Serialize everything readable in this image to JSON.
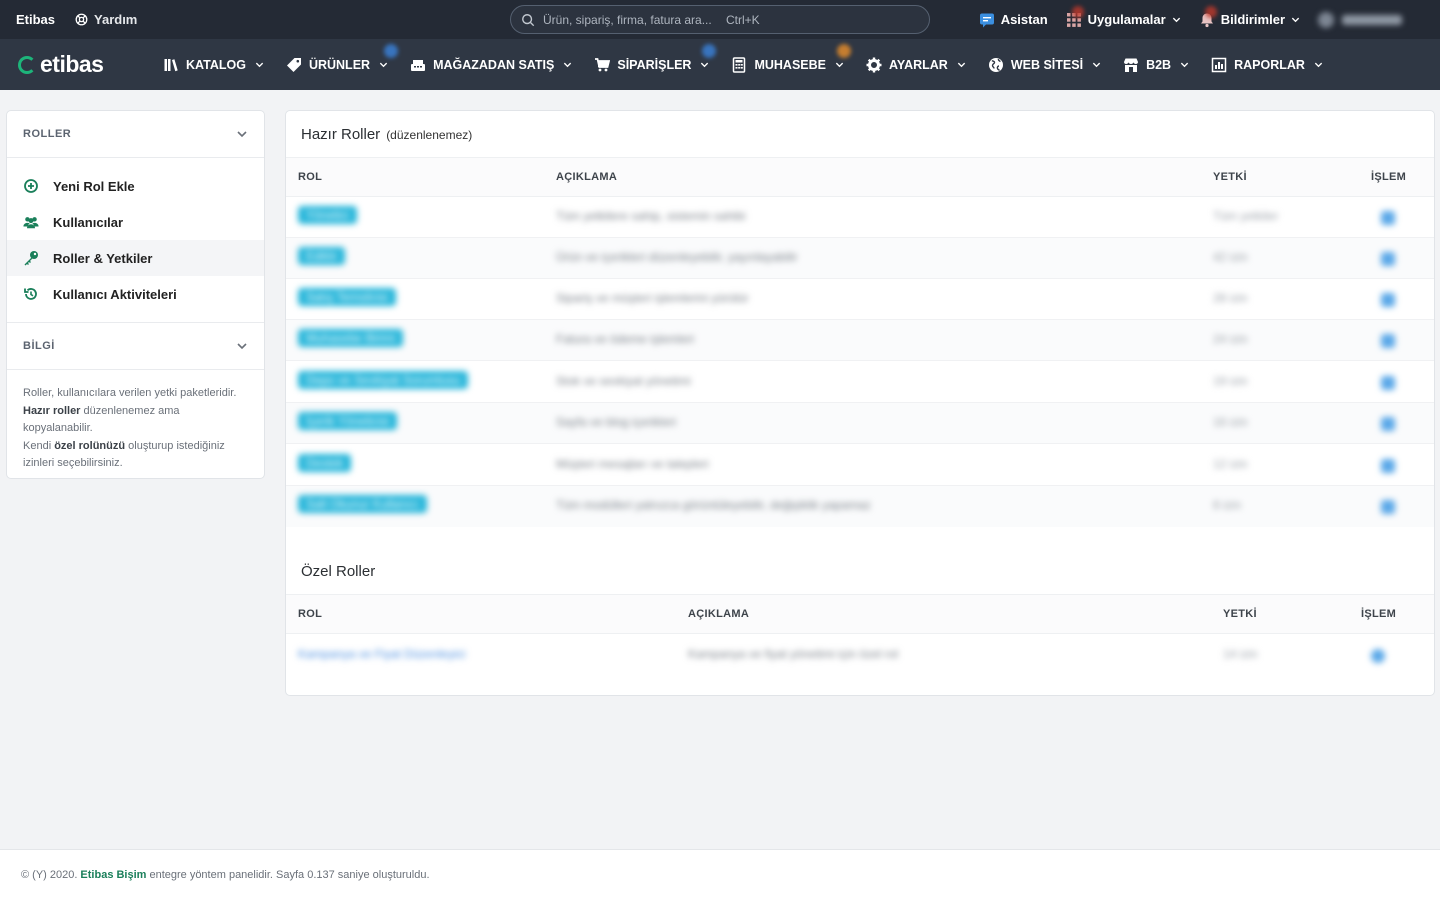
{
  "topbar": {
    "brand": "Etibas",
    "help": "Yardım",
    "search_placeholder": "Ürün, sipariş, firma, fatura ara...",
    "search_shortcut": "Ctrl+K",
    "assistant": "Asistan",
    "apps": "Uygulamalar",
    "notifications": "Bildirimler"
  },
  "navbar": {
    "logo": "etibas",
    "items": [
      {
        "label": "KATALOG",
        "icon": "books-icon"
      },
      {
        "label": "ÜRÜNLER",
        "icon": "tag-icon"
      },
      {
        "label": "MAĞAZADAN SATIŞ",
        "icon": "cash-register-icon"
      },
      {
        "label": "SİPARİŞLER",
        "icon": "cart-icon"
      },
      {
        "label": "MUHASEBE",
        "icon": "calculator-icon"
      },
      {
        "label": "AYARLAR",
        "icon": "gear-icon"
      },
      {
        "label": "WEB SİTESİ",
        "icon": "globe-icon"
      },
      {
        "label": "B2B",
        "icon": "store-icon"
      },
      {
        "label": "RAPORLAR",
        "icon": "report-icon"
      }
    ]
  },
  "sidebar": {
    "roles_header": "ROLLER",
    "items": [
      {
        "label": "Yeni Rol Ekle"
      },
      {
        "label": "Kullanıcılar"
      },
      {
        "label": "Roller & Yetkiler"
      },
      {
        "label": "Kullanıcı Aktiviteleri"
      }
    ],
    "info_header": "BİLGİ",
    "info": {
      "line1": "Roller, kullanıcılara verilen yetki paketleridir.",
      "b1": "Hazır roller",
      "t2": " düzenlenemez ama kopyalanabilir.",
      "t3": "Kendi ",
      "b2": "özel rolünüzü",
      "t4": " oluşturup istediğiniz izinleri seçebilirsiniz."
    }
  },
  "main": {
    "ready": {
      "title": "Hazır Roller",
      "subtitle": "(düzenlenemez)",
      "columns": {
        "role": "ROL",
        "desc": "AÇIKLAMA",
        "perm": "YETKİ",
        "action": "İŞLEM"
      },
      "rows": [
        {
          "role": "Yönetici",
          "desc": "Tüm yetkilere sahip, sistemin sahibi",
          "perm": "Tüm yetkiler"
        },
        {
          "role": "Editör",
          "desc": "Ürün ve içerikleri düzenleyebilir, yayınlayabilir",
          "perm": "42 izin"
        },
        {
          "role": "Satış Temsilcisi",
          "desc": "Sipariş ve müşteri işlemlerini yürütür",
          "perm": "28 izin"
        },
        {
          "role": "Muhasebe Birimi",
          "desc": "Fatura ve ödeme işlemleri",
          "perm": "24 izin"
        },
        {
          "role": "Depo ve Sevkiyat Sorumlusu",
          "desc": "Stok ve sevkiyat yönetimi",
          "perm": "19 izin"
        },
        {
          "role": "İçerik Yöneticisi",
          "desc": "Sayfa ve blog içerikleri",
          "perm": "16 izin"
        },
        {
          "role": "Destek",
          "desc": "Müşteri mesajları ve talepleri",
          "perm": "12 izin"
        },
        {
          "role": "Salt Okunur Kullanıcı",
          "desc": "Tüm modülleri yalnızca görüntüleyebilir, değişiklik yapamaz",
          "perm": "8 izin"
        }
      ]
    },
    "custom": {
      "title": "Özel Roller",
      "columns": {
        "role": "ROL",
        "desc": "AÇIKLAMA",
        "perm": "YETKİ",
        "action": "İŞLEM"
      },
      "rows": [
        {
          "role": "Kampanya ve Fiyat Düzenleyici",
          "desc": "Kampanya ve fiyat yönetimi için özel rol",
          "perm": "14 izin"
        }
      ]
    }
  },
  "footer": {
    "prefix": "© (Y) 2020.",
    "brand": "Etibas Bişim",
    "suffix": "entegre yöntem panelidir. Sayfa 0.137 saniye oluşturuldu."
  }
}
